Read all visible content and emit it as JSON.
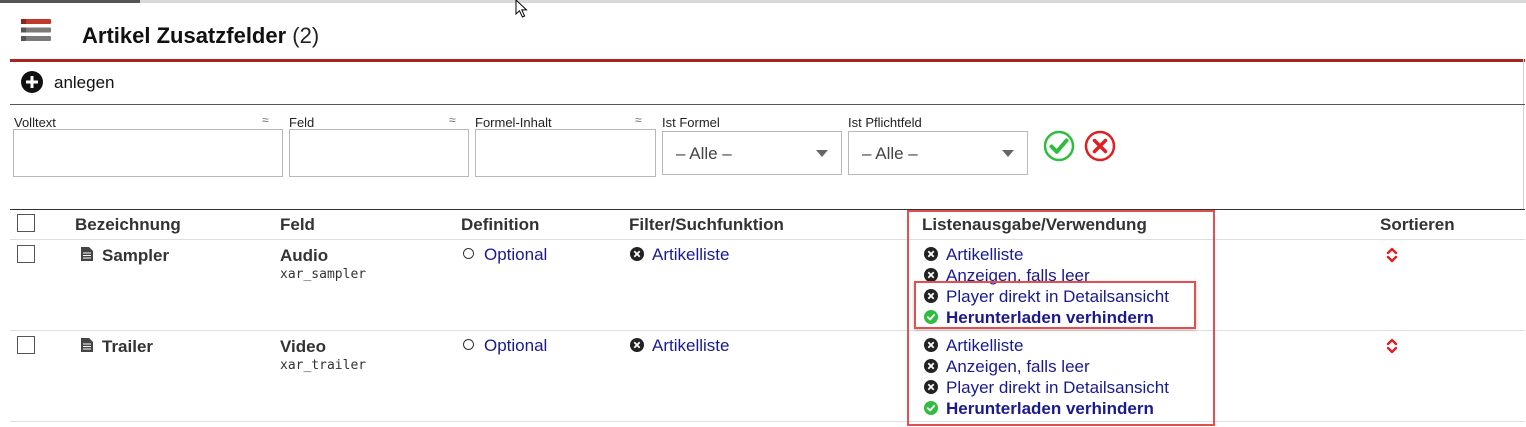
{
  "header": {
    "title": "Artikel Zusatzfelder",
    "count": "(2)",
    "create_label": "anlegen"
  },
  "filters": {
    "volltext_label": "Volltext",
    "feld_label": "Feld",
    "formel_label": "Formel-Inhalt",
    "approx_symbol": "≈",
    "ist_formel_label": "Ist Formel",
    "ist_formel_value": "– Alle –",
    "ist_pflicht_label": "Ist Pflichtfeld",
    "ist_pflicht_value": "– Alle –"
  },
  "table": {
    "columns": {
      "bezeichnung": "Bezeichnung",
      "feld": "Feld",
      "definition": "Definition",
      "filter": "Filter/Suchfunktion",
      "listenausgabe": "Listenausgabe/Verwendung",
      "sortieren": "Sortieren"
    },
    "rows": [
      {
        "name": "Sampler",
        "feld_label": "Audio",
        "feld_key": "xar_sampler",
        "definition": "Optional",
        "filter": "Artikelliste",
        "usage": [
          {
            "label": "Artikelliste",
            "state": "off"
          },
          {
            "label": "Anzeigen, falls leer",
            "state": "off"
          },
          {
            "label": "Player direkt in Detailsansicht",
            "state": "off"
          },
          {
            "label": "Herunterladen verhindern",
            "state": "on"
          }
        ]
      },
      {
        "name": "Trailer",
        "feld_label": "Video",
        "feld_key": "xar_trailer",
        "definition": "Optional",
        "filter": "Artikelliste",
        "usage": [
          {
            "label": "Artikelliste",
            "state": "off"
          },
          {
            "label": "Anzeigen, falls leer",
            "state": "off"
          },
          {
            "label": "Player direkt in Detailsansicht",
            "state": "off"
          },
          {
            "label": "Herunterladen verhindern",
            "state": "on"
          }
        ]
      }
    ]
  },
  "colors": {
    "accent_rule": "#a8241c",
    "link": "#1a1a8c",
    "ok_green": "#2ebd3e",
    "cancel_red": "#e02020",
    "highlight": "#e05050"
  }
}
